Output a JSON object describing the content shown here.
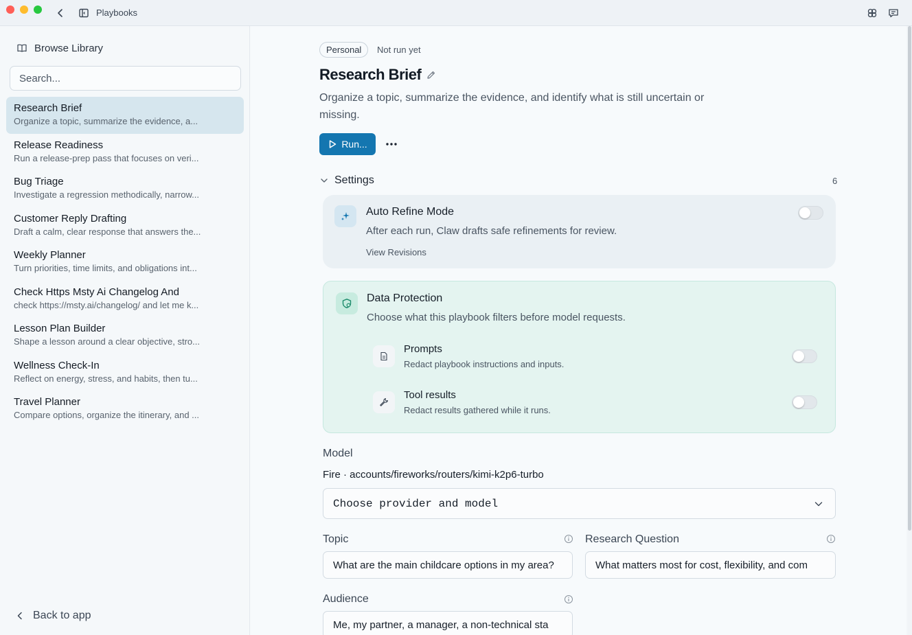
{
  "window": {
    "title": "Playbooks"
  },
  "sidebar": {
    "browse_label": "Browse Library",
    "search_placeholder": "Search...",
    "items": [
      {
        "title": "Research Brief",
        "desc": "Organize a topic, summarize the evidence, a..."
      },
      {
        "title": "Release Readiness",
        "desc": "Run a release-prep pass that focuses on veri..."
      },
      {
        "title": "Bug Triage",
        "desc": "Investigate a regression methodically, narrow..."
      },
      {
        "title": "Customer Reply Drafting",
        "desc": "Draft a calm, clear response that answers the..."
      },
      {
        "title": "Weekly Planner",
        "desc": "Turn priorities, time limits, and obligations int..."
      },
      {
        "title": "Check Https Msty Ai Changelog And",
        "desc": "check https://msty.ai/changelog/ and let me k..."
      },
      {
        "title": "Lesson Plan Builder",
        "desc": "Shape a lesson around a clear objective, stro..."
      },
      {
        "title": "Wellness Check-In",
        "desc": "Reflect on energy, stress, and habits, then tu..."
      },
      {
        "title": "Travel Planner",
        "desc": "Compare options, organize the itinerary, and ..."
      }
    ],
    "active_index": 0,
    "back_label": "Back to app"
  },
  "main": {
    "badge": "Personal",
    "run_status": "Not run yet",
    "title": "Research Brief",
    "description": "Organize a topic, summarize the evidence, and identify what is still uncertain or missing.",
    "run_label": "Run...",
    "settings": {
      "label": "Settings",
      "count": "6",
      "auto_refine": {
        "title": "Auto Refine Mode",
        "desc": "After each run, Claw drafts safe refinements for review.",
        "link": "View Revisions",
        "enabled": false
      },
      "data_protection": {
        "title": "Data Protection",
        "desc": "Choose what this playbook filters before model requests.",
        "options": [
          {
            "title": "Prompts",
            "desc": "Redact playbook instructions and inputs.",
            "enabled": false
          },
          {
            "title": "Tool results",
            "desc": "Redact results gathered while it runs.",
            "enabled": false
          }
        ]
      }
    },
    "model": {
      "label": "Model",
      "value": "Fire · accounts/fireworks/routers/kimi-k2p6-turbo",
      "select_placeholder": "Choose provider and model"
    },
    "fields": {
      "topic": {
        "label": "Topic",
        "value": "What are the main childcare options in my area?"
      },
      "research_question": {
        "label": "Research Question",
        "value": "What matters most for cost, flexibility, and com"
      },
      "audience": {
        "label": "Audience",
        "value": "Me, my partner, a manager, a non-technical sta"
      }
    }
  },
  "colors": {
    "accent": "#1476b0",
    "active_item_bg": "#d6e6ee",
    "protection_bg": "#e4f4f0"
  }
}
